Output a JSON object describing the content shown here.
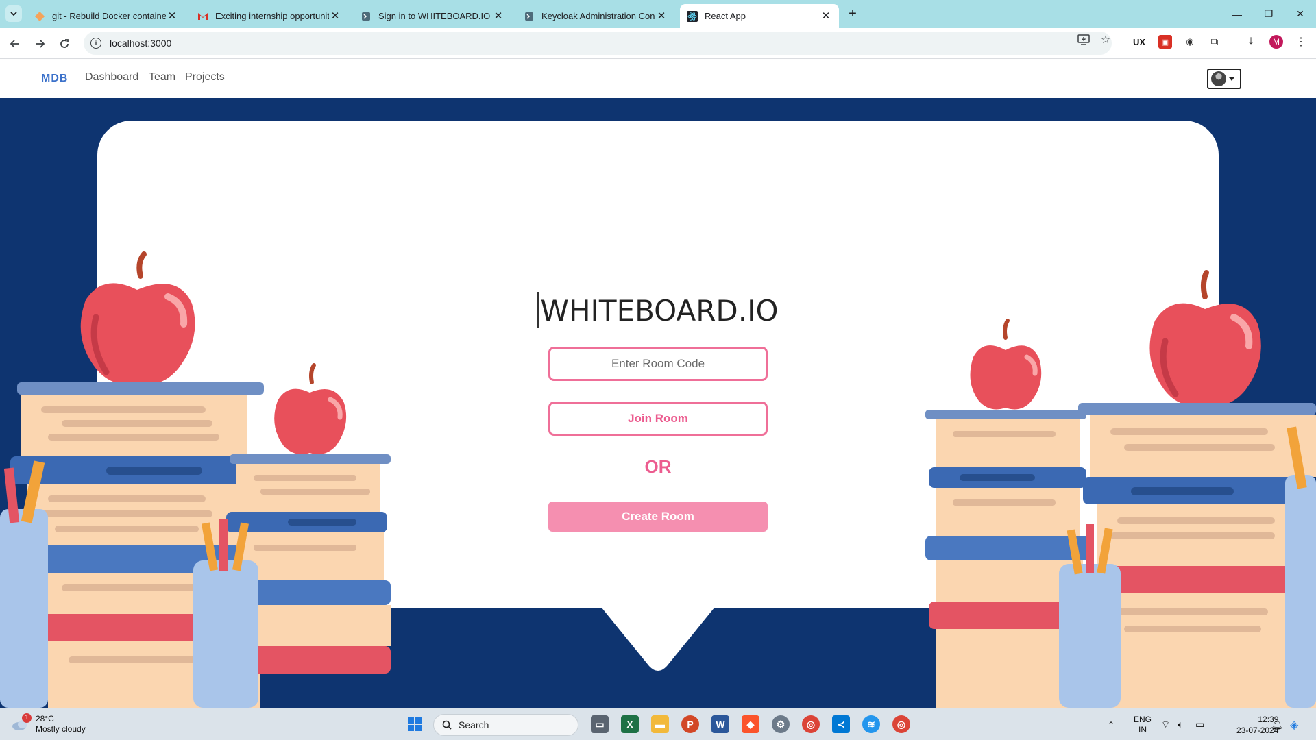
{
  "browser": {
    "tabs": [
      {
        "title": "git - Rebuild Docker container o",
        "icon": "git-favicon"
      },
      {
        "title": "Exciting internship opportunity",
        "icon": "gmail-favicon"
      },
      {
        "title": "Sign in to WHITEBOARD.IO",
        "icon": "keycloak-favicon"
      },
      {
        "title": "Keycloak Administration Consol",
        "icon": "keycloak-favicon"
      },
      {
        "title": "React App",
        "icon": "react-favicon",
        "active": true
      }
    ],
    "url": "localhost:3000",
    "profile_initial": "M"
  },
  "navbar": {
    "brand": "MDB",
    "links": [
      "Dashboard",
      "Team",
      "Projects"
    ]
  },
  "main": {
    "title": "WHITEBOARD.IO",
    "room_code_placeholder": "Enter Room Code",
    "room_code_value": "",
    "join_label": "Join Room",
    "or_label": "OR",
    "create_label": "Create Room"
  },
  "colors": {
    "accent_pink": "#ec5c8f",
    "create_button": "#f58fb0",
    "background_navy": "#0e3470",
    "brand_blue": "#3b71ca"
  },
  "taskbar": {
    "weather_temp": "28°C",
    "weather_desc": "Mostly cloudy",
    "weather_badge": "1",
    "search_label": "Search",
    "language_line1": "ENG",
    "language_line2": "IN",
    "time": "12:39",
    "date": "23-07-2024"
  }
}
